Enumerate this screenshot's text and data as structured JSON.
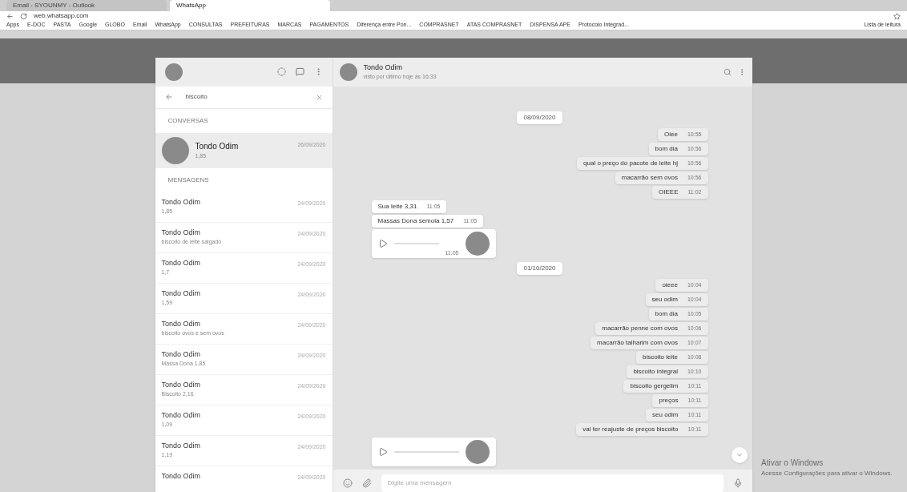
{
  "browser": {
    "tabs": [
      {
        "label": "Email - SYOUNMY - Outlook",
        "selected": false
      },
      {
        "label": "WhatsApp",
        "selected": true
      }
    ],
    "url": "web.whatsapp.com",
    "bookmarks": [
      "Apps",
      "E-DOC",
      "PASTA",
      "Google",
      "GLOBO",
      "Email",
      "WhatsApp",
      "CONSULTAS",
      "PREFEITURAS",
      "MARCAS",
      "PAGAMENTOS",
      "Diferença entre Pon...",
      "COMPRASNET",
      "ATAS COMPRASNET",
      "DISPENSA APE",
      "Protocolo Integrad..."
    ],
    "reading_list": "Lista de leitura"
  },
  "sidebar": {
    "search": {
      "value": "biscoito"
    },
    "conversations_label": "CONVERSAS",
    "conversation": {
      "name": "Tondo Odim",
      "preview": "1,85",
      "date": "26/09/2020",
      "selected": true
    },
    "messages_label": "MENSAGENS",
    "results": [
      {
        "name": "Tondo Odim",
        "preview": "1,85",
        "date": "24/09/2020"
      },
      {
        "name": "Tondo Odim",
        "preview": "biscoito de leite salgado",
        "date": "24/09/2020"
      },
      {
        "name": "Tondo Odim",
        "preview": "1,7",
        "date": "24/09/2020"
      },
      {
        "name": "Tondo Odim",
        "preview": "1,59",
        "date": "24/09/2020"
      },
      {
        "name": "Tondo Odim",
        "preview": "biscoito ovos e sem ovos",
        "date": "24/09/2020"
      },
      {
        "name": "Tondo Odim",
        "preview": "Massa Dona 1,85",
        "date": "24/09/2020"
      },
      {
        "name": "Tondo Odim",
        "preview": "Biscoito 2,16",
        "date": "24/09/2020"
      },
      {
        "name": "Tondo Odim",
        "preview": "1,09",
        "date": "24/09/2020"
      },
      {
        "name": "Tondo Odim",
        "preview": "1,19",
        "date": "24/09/2020"
      },
      {
        "name": "Tondo Odim",
        "date": "24/09/2020"
      }
    ]
  },
  "chat": {
    "name": "Tondo Odim",
    "status": "visto por último hoje às 16:33",
    "messages": [
      {
        "kind": "date",
        "text": "08/09/2020"
      },
      {
        "kind": "text",
        "outgoing": true,
        "text": "Oiee",
        "time": "10:55"
      },
      {
        "kind": "text",
        "outgoing": true,
        "text": "bom dia",
        "time": "10:56"
      },
      {
        "kind": "text",
        "outgoing": true,
        "text": "qual o preço do pacote de leite hj",
        "time": "10:56"
      },
      {
        "kind": "text",
        "outgoing": true,
        "text": "macarrão sem ovos",
        "time": "10:56"
      },
      {
        "kind": "text",
        "outgoing": true,
        "text": "OIEEE",
        "time": "11:02"
      },
      {
        "kind": "text",
        "outgoing": false,
        "text": "Sua leite 3,31",
        "time": "11:05"
      },
      {
        "kind": "text",
        "outgoing": false,
        "text": "Massas Dona semola 1,57",
        "time": "11:05"
      },
      {
        "kind": "voice",
        "outgoing": false,
        "time": "11:05"
      },
      {
        "kind": "date",
        "text": "01/10/2020"
      },
      {
        "kind": "text",
        "outgoing": true,
        "text": "oieee",
        "time": "10:04"
      },
      {
        "kind": "text",
        "outgoing": true,
        "text": "seu odim",
        "time": "10:04"
      },
      {
        "kind": "text",
        "outgoing": true,
        "text": "bom dia",
        "time": "10:05"
      },
      {
        "kind": "text",
        "outgoing": true,
        "text": "macarrão penne com ovos",
        "time": "10:06"
      },
      {
        "kind": "text",
        "outgoing": true,
        "text": "macarrão talharim com ovos",
        "time": "10:07"
      },
      {
        "kind": "text",
        "outgoing": true,
        "text": "biscoito leite",
        "time": "10:08"
      },
      {
        "kind": "text",
        "outgoing": true,
        "text": "biscoito integral",
        "time": "10:10"
      },
      {
        "kind": "text",
        "outgoing": true,
        "text": "biscoito gergelim",
        "time": "10:11"
      },
      {
        "kind": "text",
        "outgoing": true,
        "text": "preços",
        "time": "10:11"
      },
      {
        "kind": "text",
        "outgoing": true,
        "text": "seu odim",
        "time": "10:11"
      },
      {
        "kind": "text",
        "outgoing": true,
        "text": "vai ter reajuste de preços biscoito",
        "time": "10:11"
      },
      {
        "kind": "voice",
        "outgoing": false
      }
    ],
    "input": {
      "placeholder": "Digite uma mensagem"
    }
  },
  "activation": {
    "title": "Ativar o Windows",
    "text": "Acesse Configurações para ativar o Windows."
  }
}
